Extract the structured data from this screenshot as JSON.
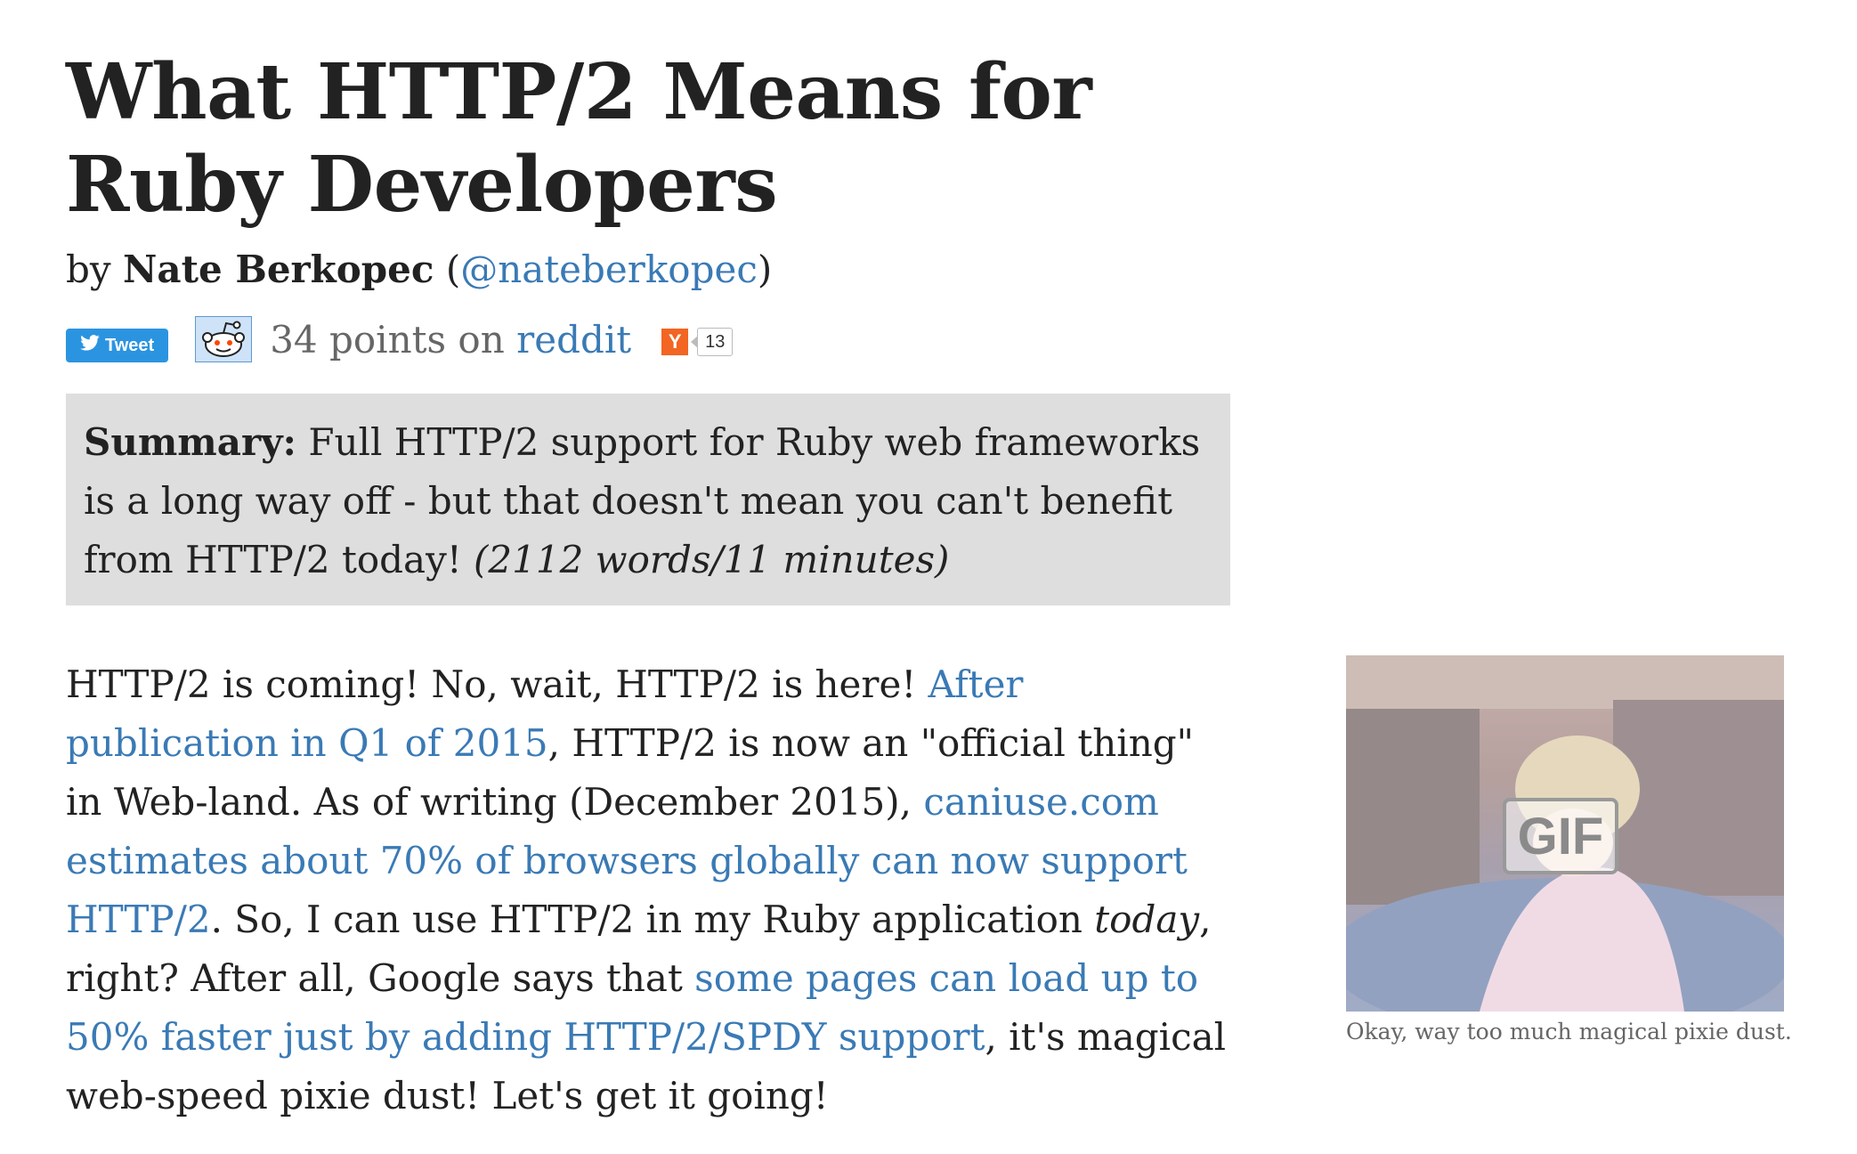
{
  "article": {
    "title": "What HTTP/2 Means for Ruby Developers",
    "byline": {
      "by": "by",
      "author": "Nate Berkopec",
      "open_paren": " (",
      "handle": "@nateberkopec",
      "close_paren": ")"
    },
    "share": {
      "tweet_label": "Tweet",
      "reddit_points": "34 points on",
      "reddit_link": "reddit",
      "hn_icon_letter": "Y",
      "hn_count": "13"
    },
    "summary": {
      "label": "Summary:",
      "text": " Full HTTP/2 support for Ruby web frameworks is a long way off - but that doesn't mean you can't benefit from HTTP/2 today! ",
      "meta": "(2112 words/11 minutes)"
    },
    "paragraph": {
      "t1": "HTTP/2 is coming! No, wait, HTTP/2 is here! ",
      "link1": "After publication in Q1 of 2015",
      "t2": ", HTTP/2 is now an \"official thing\" in Web-land. As of writing (December 2015), ",
      "link2": "caniuse.com estimates about 70% of browsers globally can now support HTTP/2",
      "t3": ". So, I can use HTTP/2 in my Ruby application ",
      "em": "today",
      "t4": ", right? After all, Google says that ",
      "link3": "some pages can load up to 50% faster just by adding HTTP/2/SPDY support",
      "t5": ", it's magical web-speed pixie dust! Let's get it going!"
    },
    "figure": {
      "badge": "GIF",
      "caption": "Okay, way too much magical pixie dust."
    }
  },
  "colors": {
    "link": "#3a7ab5",
    "text": "#222222",
    "summary_bg": "#dedede",
    "tweet_bg": "#2b94e1",
    "hn_orange": "#f26522"
  }
}
